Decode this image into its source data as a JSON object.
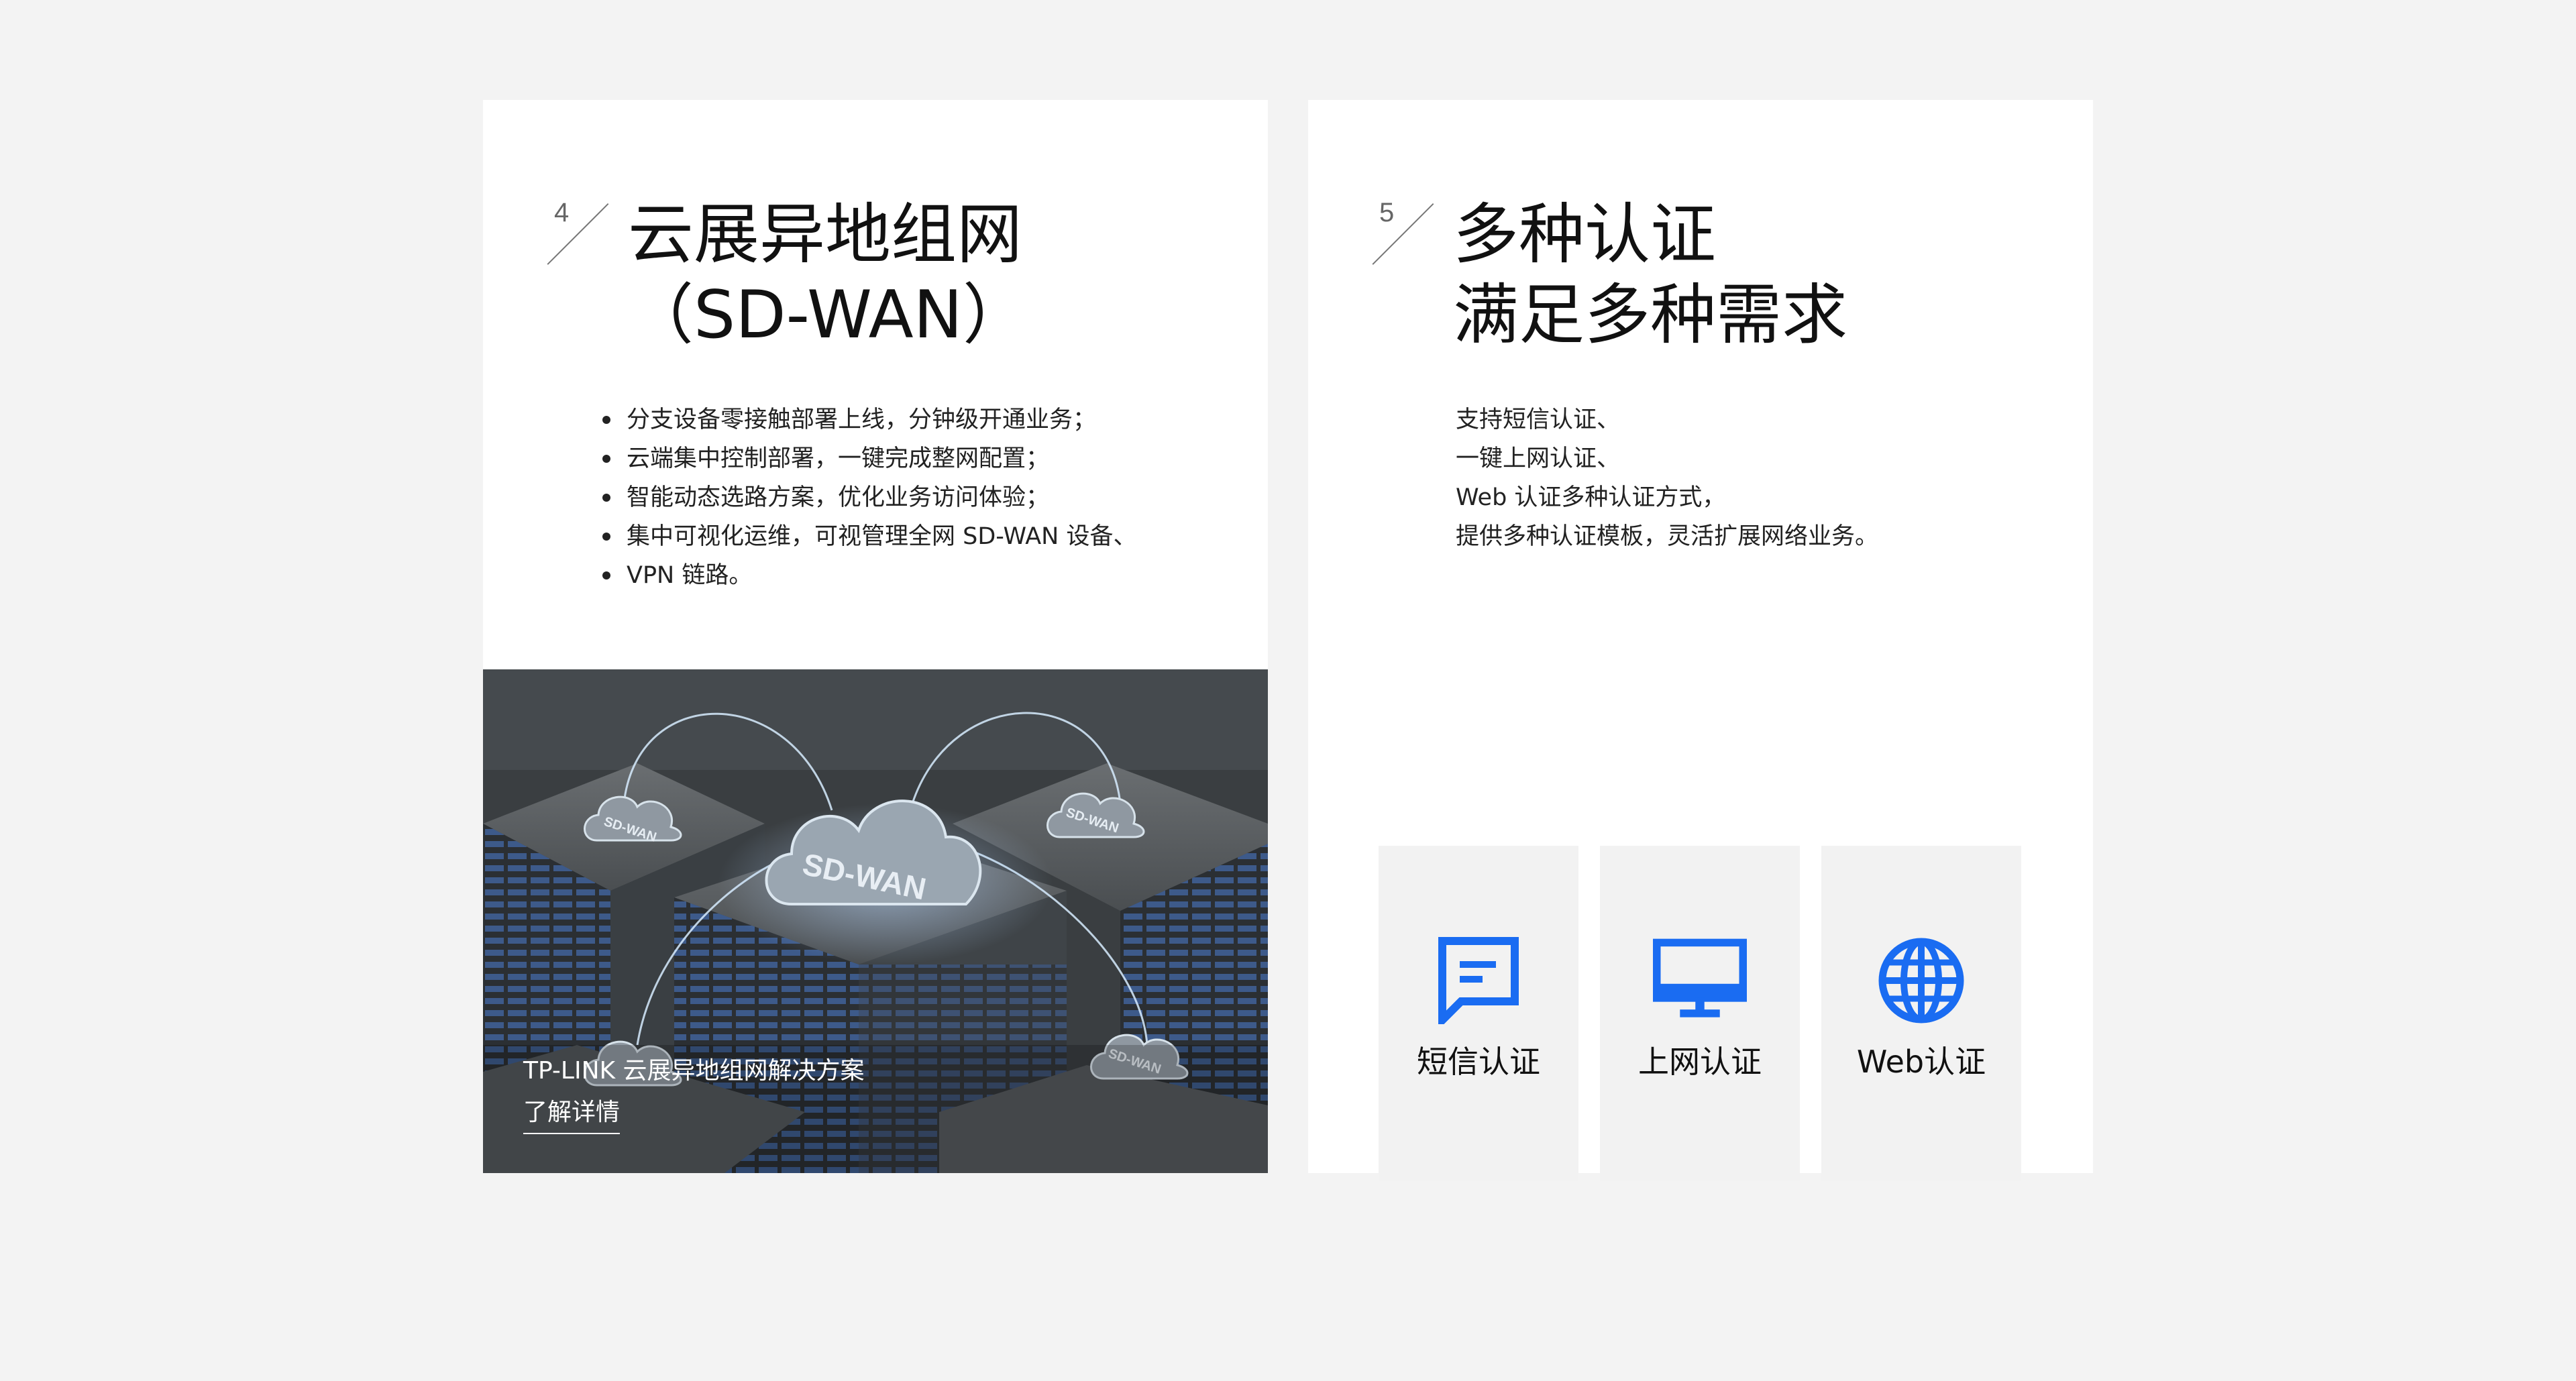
{
  "colors": {
    "page_bg": "#f3f3f3",
    "card_bg": "#ffffff",
    "accent_blue": "#1a6cf2",
    "tile_bg": "#f2f2f2"
  },
  "section4": {
    "number": "4",
    "title_line1": "云展异地组网",
    "title_line2": "（SD-WAN）",
    "bullets": [
      "分支设备零接触部署上线，分钟级开通业务；",
      "云端集中控制部署，一键完成整网配置；",
      "智能动态选路方案，优化业务访问体验；",
      "集中可视化运维，可视管理全网 SD-WAN 设备、",
      "VPN 链路。"
    ],
    "image": {
      "cloud_label": "SD-WAN",
      "caption": "TP-LINK 云展异地组网解决方案",
      "link": "了解详情"
    }
  },
  "section5": {
    "number": "5",
    "title_line1": "多种认证",
    "title_line2": "满足多种需求",
    "lines": [
      "支持短信认证、",
      "一键上网认证、",
      "Web 认证多种认证方式，",
      "提供多种认证模板，灵活扩展网络业务。"
    ],
    "tiles": [
      {
        "icon": "message-icon",
        "label": "短信认证"
      },
      {
        "icon": "monitor-icon",
        "label": "上网认证"
      },
      {
        "icon": "globe-icon",
        "label": "Web认证"
      }
    ]
  }
}
